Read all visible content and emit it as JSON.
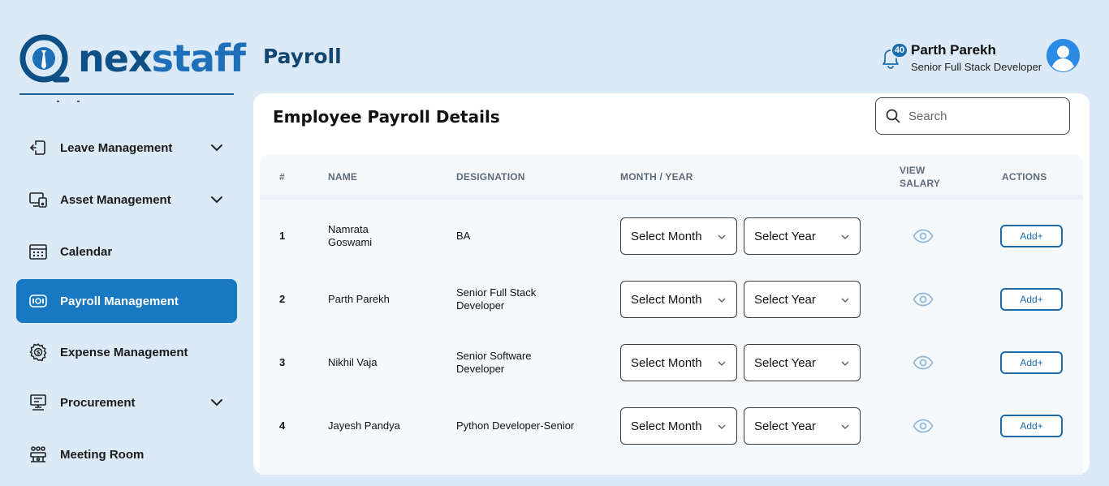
{
  "brand": {
    "logo_prefix": "nex",
    "logo_suffix": "staff"
  },
  "sidebar": {
    "items": [
      {
        "label": "Leave Management",
        "icon": "logout-icon",
        "has_submenu": true,
        "active": false
      },
      {
        "label": "Asset Management",
        "icon": "devices-icon",
        "has_submenu": true,
        "active": false
      },
      {
        "label": "Calendar",
        "icon": "calendar-icon",
        "has_submenu": false,
        "active": false
      },
      {
        "label": "Payroll Management",
        "icon": "payroll-icon",
        "has_submenu": false,
        "active": true
      },
      {
        "label": "Expense Management",
        "icon": "expense-gear-icon",
        "has_submenu": false,
        "active": false
      },
      {
        "label": "Procurement",
        "icon": "procurement-icon",
        "has_submenu": true,
        "active": false
      },
      {
        "label": "Meeting Room",
        "icon": "meeting-room-icon",
        "has_submenu": false,
        "active": false
      }
    ]
  },
  "header": {
    "title": "Payroll",
    "notification_count": "40",
    "user_name": "Parth Parekh",
    "user_role": "Senior Full Stack Developer"
  },
  "main": {
    "card_title": "Employee Payroll Details",
    "search_placeholder": "Search",
    "columns": {
      "index": "#",
      "name": "NAME",
      "designation": "DESIGNATION",
      "month_year": "MONTH / YEAR",
      "view_salary_1": "VIEW",
      "view_salary_2": "SALARY",
      "actions": "ACTIONS"
    },
    "rows": [
      {
        "index": "1",
        "name_1": "Namrata",
        "name_2": "Goswami",
        "designation_1": "BA",
        "designation_2": "",
        "month": "Select Month",
        "year": "Select Year",
        "action": "Add+"
      },
      {
        "index": "2",
        "name_1": "Parth Parekh",
        "name_2": "",
        "designation_1": "Senior Full Stack",
        "designation_2": "Developer",
        "month": "Select Month",
        "year": "Select Year",
        "action": "Add+"
      },
      {
        "index": "3",
        "name_1": "Nikhil Vaja",
        "name_2": "",
        "designation_1": "Senior Software",
        "designation_2": "Developer",
        "month": "Select Month",
        "year": "Select Year",
        "action": "Add+"
      },
      {
        "index": "4",
        "name_1": "Jayesh Pandya",
        "name_2": "",
        "designation_1": "Python Developer-Senior",
        "designation_2": "",
        "month": "Select Month",
        "year": "Select Year",
        "action": "Add+"
      }
    ]
  },
  "colors": {
    "background": "#dceaf7",
    "accent": "#1878c2",
    "title": "#12466f",
    "button_border": "#1c6cad"
  }
}
